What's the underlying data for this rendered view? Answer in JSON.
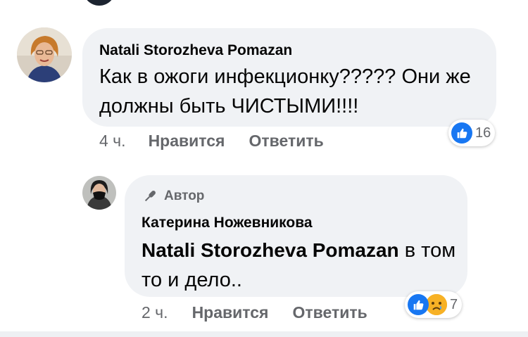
{
  "comments": [
    {
      "author": "Natali Storozheva Pomazan",
      "text": "Как в ожоги инфекционку????? Они же должны быть ЧИСТЫМИ!!!!",
      "time": "4 ч.",
      "like_label": "Нравится",
      "reply_label": "Ответить",
      "reactions": {
        "icons": [
          "like-icon"
        ],
        "count": "16"
      }
    },
    {
      "author_badge": "Автор",
      "author": "Катерина Ножевникова",
      "mention": "Natali Storozheva Pomazan",
      "text": " в том то и дело..",
      "time": "2 ч.",
      "like_label": "Нравится",
      "reply_label": "Ответить",
      "reactions": {
        "icons": [
          "like-icon",
          "sad-icon"
        ],
        "count": "7"
      }
    }
  ],
  "colors": {
    "like": "#1877f2",
    "sad": "#f7b125",
    "bubble": "#f0f2f5",
    "meta": "#65676b"
  }
}
